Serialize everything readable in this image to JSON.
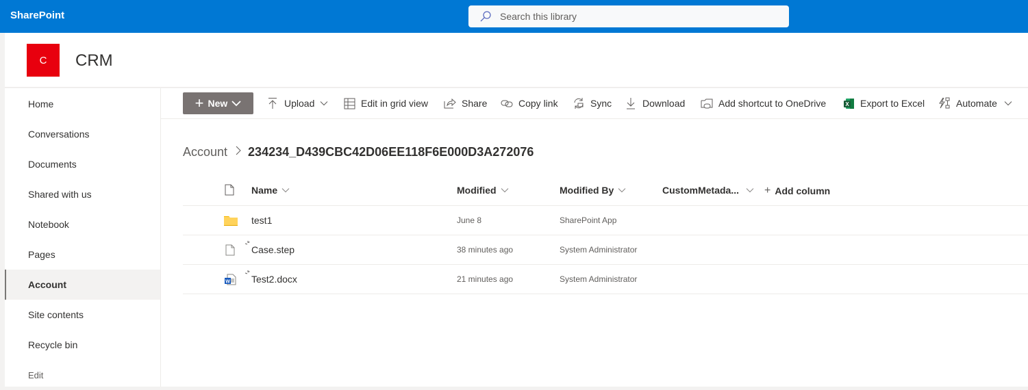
{
  "suitebar": {
    "app_name": "SharePoint",
    "search_placeholder": "Search this library",
    "color": "#0078d4"
  },
  "site": {
    "logo_letter": "C",
    "logo_color": "#e8000e",
    "title": "CRM"
  },
  "nav": {
    "items": [
      {
        "label": "Home"
      },
      {
        "label": "Conversations"
      },
      {
        "label": "Documents"
      },
      {
        "label": "Shared with us"
      },
      {
        "label": "Notebook"
      },
      {
        "label": "Pages"
      },
      {
        "label": "Account",
        "selected": true
      },
      {
        "label": "Site contents"
      },
      {
        "label": "Recycle bin"
      }
    ],
    "edit_label": "Edit"
  },
  "commands": {
    "new": "New",
    "upload": "Upload",
    "edit_grid": "Edit in grid view",
    "share": "Share",
    "copy_link": "Copy link",
    "sync": "Sync",
    "download": "Download",
    "add_shortcut": "Add shortcut to OneDrive",
    "export_excel": "Export to Excel",
    "automate": "Automate"
  },
  "breadcrumb": {
    "parent": "Account",
    "current": "234234_D439CBC42D06EE118F6E000D3A272076"
  },
  "list": {
    "columns": {
      "name": "Name",
      "modified": "Modified",
      "modified_by": "Modified By",
      "custom": "CustomMetada...",
      "add_column": "Add column"
    },
    "rows": [
      {
        "type": "folder",
        "name": "test1",
        "modified": "June 8",
        "modified_by": "SharePoint App",
        "new": false
      },
      {
        "type": "file",
        "name": "Case.step",
        "modified": "38 minutes ago",
        "modified_by": "System Administrator",
        "new": true
      },
      {
        "type": "word",
        "name": "Test2.docx",
        "modified": "21 minutes ago",
        "modified_by": "System Administrator",
        "new": true
      }
    ]
  }
}
